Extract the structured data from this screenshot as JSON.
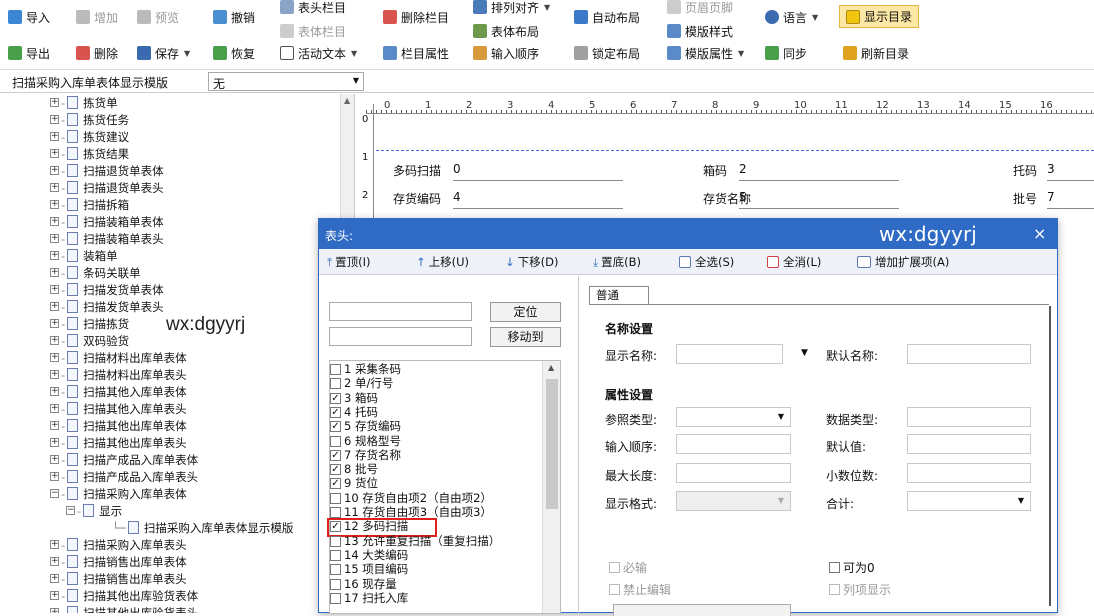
{
  "toolbar": {
    "row1": [
      "导入",
      "增加",
      "预览",
      "撤销",
      "表头栏目",
      "删除栏目",
      "排列对齐",
      "自动布局",
      "页眉页脚",
      "语言",
      "显示目录"
    ],
    "row1b": [
      "表体栏目",
      "表体布局",
      "模版样式"
    ],
    "row2": [
      "导出",
      "删除",
      "保存",
      "恢复",
      "活动文本",
      "栏目属性",
      "输入顺序",
      "锁定布局",
      "模版属性",
      "同步",
      "刷新目录"
    ],
    "template_label": "扫描采购入库单表体显示模版",
    "template_value": "无"
  },
  "tree": [
    {
      "t": "拣货单",
      "s": "+"
    },
    {
      "t": "拣货任务",
      "s": "+"
    },
    {
      "t": "拣货建议",
      "s": "+"
    },
    {
      "t": "拣货结果",
      "s": "+"
    },
    {
      "t": "扫描退货单表体",
      "s": "+"
    },
    {
      "t": "扫描退货单表头",
      "s": "+"
    },
    {
      "t": "扫描拆箱",
      "s": "+"
    },
    {
      "t": "扫描装箱单表体",
      "s": "+"
    },
    {
      "t": "扫描装箱单表头",
      "s": "+"
    },
    {
      "t": "装箱单",
      "s": "+"
    },
    {
      "t": "条码关联单",
      "s": "+"
    },
    {
      "t": "扫描发货单表体",
      "s": "+"
    },
    {
      "t": "扫描发货单表头",
      "s": "+"
    },
    {
      "t": "扫描拣货",
      "s": "+"
    },
    {
      "t": "双码验货",
      "s": "+"
    },
    {
      "t": "扫描材料出库单表体",
      "s": "+"
    },
    {
      "t": "扫描材料出库单表头",
      "s": "+"
    },
    {
      "t": "扫描其他入库单表体",
      "s": "+"
    },
    {
      "t": "扫描其他入库单表头",
      "s": "+"
    },
    {
      "t": "扫描其他出库单表体",
      "s": "+"
    },
    {
      "t": "扫描其他出库单表头",
      "s": "+"
    },
    {
      "t": "扫描产成品入库单表体",
      "s": "+"
    },
    {
      "t": "扫描产成品入库单表头",
      "s": "+"
    },
    {
      "t": "扫描采购入库单表体",
      "s": "-"
    },
    {
      "t": "显示",
      "s": "-",
      "lvl": 1
    },
    {
      "t": "扫描采购入库单表体显示模版",
      "s": "",
      "lvl": 2
    },
    {
      "t": "扫描采购入库单表头",
      "s": "+"
    },
    {
      "t": "扫描销售出库单表体",
      "s": "+"
    },
    {
      "t": "扫描销售出库单表头",
      "s": "+"
    },
    {
      "t": "扫描其他出库验货表体",
      "s": "+"
    },
    {
      "t": "扫描其他出库验货表头",
      "s": "+"
    }
  ],
  "watermark": "wx:dgyyrj",
  "ruler": [
    "1",
    "2",
    "3",
    "4",
    "5",
    "6",
    "7",
    "8",
    "9",
    "10",
    "11",
    "12",
    "13",
    "14",
    "15",
    "16"
  ],
  "canvas": {
    "row1": [
      {
        "l": "多码扫描",
        "v": "0"
      },
      {
        "l": "箱码",
        "v": "2"
      },
      {
        "l": "托码",
        "v": "3"
      }
    ],
    "row2": [
      {
        "l": "存货编码",
        "v": "4"
      },
      {
        "l": "存货名称",
        "v": "5"
      },
      {
        "l": "批号",
        "v": "7"
      }
    ]
  },
  "dialog": {
    "title": "表头:",
    "close": "×",
    "buttons": [
      "置顶(I)",
      "上移(U)",
      "下移(D)",
      "置底(B)",
      "全选(S)",
      "全消(L)",
      "增加扩展项(A)"
    ],
    "locate": "定位",
    "moveto": "移动到",
    "items": [
      {
        "c": false,
        "t": "1  采集条码"
      },
      {
        "c": false,
        "t": "2  单/行号"
      },
      {
        "c": true,
        "t": "3  箱码"
      },
      {
        "c": true,
        "t": "4  托码"
      },
      {
        "c": true,
        "t": "5  存货编码"
      },
      {
        "c": false,
        "t": "6  规格型号"
      },
      {
        "c": true,
        "t": "7  存货名称"
      },
      {
        "c": true,
        "t": "8  批号"
      },
      {
        "c": true,
        "t": "9  货位"
      },
      {
        "c": false,
        "t": "10  存货自由项2（自由项2）"
      },
      {
        "c": false,
        "t": "11  存货自由项3（自由项3）"
      },
      {
        "c": true,
        "t": "12  多码扫描"
      },
      {
        "c": false,
        "t": "13  允许重复扫描（重复扫描）"
      },
      {
        "c": false,
        "t": "14  大类编码"
      },
      {
        "c": false,
        "t": "15  项目编码"
      },
      {
        "c": false,
        "t": "16  现存量"
      },
      {
        "c": false,
        "t": "17  扫托入库"
      }
    ],
    "tab": "普通",
    "name_section": "名称设置",
    "display_name": "显示名称:",
    "default_name": "默认名称:",
    "attr_section": "属性设置",
    "ref_type": "参照类型:",
    "data_type": "数据类型:",
    "input_order": "输入顺序:",
    "default_val": "默认值:",
    "max_len": "最大长度:",
    "decimals": "小数位数:",
    "display_fmt": "显示格式:",
    "total": "合计:",
    "required": "必输",
    "nullable": "可为0",
    "forbid_edit": "禁止编辑",
    "list_show": "列项显示"
  }
}
